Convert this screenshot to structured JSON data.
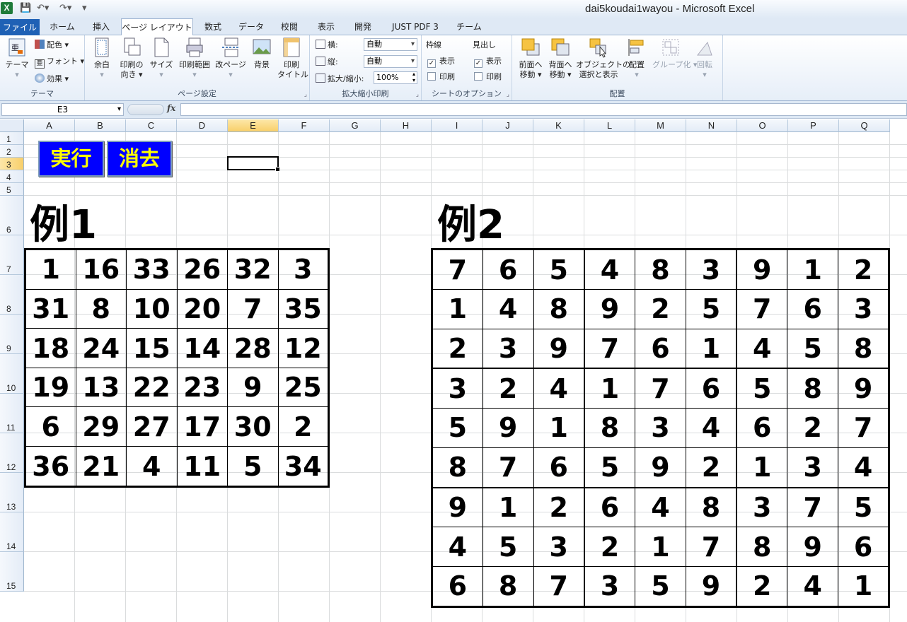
{
  "window": {
    "title": "dai5koudai1wayou - Microsoft Excel"
  },
  "tabs": [
    "ファイル",
    "ホーム",
    "挿入",
    "ページ レイアウト",
    "数式",
    "データ",
    "校閲",
    "表示",
    "開発",
    "JUST PDF 3",
    "チーム"
  ],
  "ribbon": {
    "theme": {
      "label": "テーマ",
      "theme_button": "テーマ",
      "colors": "配色",
      "fonts": "フォント",
      "effects": "効果"
    },
    "page_setup": {
      "label": "ページ設定",
      "margins": "余白",
      "orientation": [
        "印刷の",
        "向き"
      ],
      "size": "サイズ",
      "print_area": "印刷範囲",
      "breaks": "改ページ",
      "background": "背景",
      "print_titles": [
        "印刷",
        "タイトル"
      ]
    },
    "scale": {
      "label": "拡大縮小印刷",
      "width_label": "横:",
      "width_value": "自動",
      "height_label": "縦:",
      "height_value": "自動",
      "scale_label": "拡大/縮小:",
      "scale_value": "100%"
    },
    "sheet_options": {
      "label": "シートのオプション",
      "gridlines": "枠線",
      "headings": "見出し",
      "view": "表示",
      "print": "印刷"
    },
    "arrange": {
      "label": "配置",
      "bring_forward": [
        "前面へ",
        "移動"
      ],
      "send_backward": [
        "背面へ",
        "移動"
      ],
      "selection_pane": [
        "オブジェクトの",
        "選択と表示"
      ],
      "align": "配置",
      "group": "グループ化",
      "rotate": "回転"
    }
  },
  "formula_bar": {
    "name_box": "E3",
    "fx": "fx",
    "value": ""
  },
  "columns": [
    "A",
    "B",
    "C",
    "D",
    "E",
    "F",
    "G",
    "H",
    "I",
    "J",
    "K",
    "L",
    "M",
    "N",
    "O",
    "P",
    "Q"
  ],
  "rows": [
    "1",
    "2",
    "3",
    "4",
    "5",
    "6",
    "7",
    "8",
    "9",
    "10",
    "11",
    "12",
    "13",
    "14",
    "15"
  ],
  "selected_cell": {
    "col": "E",
    "row": "3"
  },
  "buttons": {
    "run": "実行",
    "clear": "消去"
  },
  "example1": {
    "title": "例1",
    "grid": [
      [
        "1",
        "16",
        "33",
        "26",
        "32",
        "3"
      ],
      [
        "31",
        "8",
        "10",
        "20",
        "7",
        "35"
      ],
      [
        "18",
        "24",
        "15",
        "14",
        "28",
        "12"
      ],
      [
        "19",
        "13",
        "22",
        "23",
        "9",
        "25"
      ],
      [
        "6",
        "29",
        "27",
        "17",
        "30",
        "2"
      ],
      [
        "36",
        "21",
        "4",
        "11",
        "5",
        "34"
      ]
    ]
  },
  "example2": {
    "title": "例2",
    "grid": [
      [
        "7",
        "6",
        "5",
        "4",
        "8",
        "3",
        "9",
        "1",
        "2"
      ],
      [
        "1",
        "4",
        "8",
        "9",
        "2",
        "5",
        "7",
        "6",
        "3"
      ],
      [
        "2",
        "3",
        "9",
        "7",
        "6",
        "1",
        "4",
        "5",
        "8"
      ],
      [
        "3",
        "2",
        "4",
        "1",
        "7",
        "6",
        "5",
        "8",
        "9"
      ],
      [
        "5",
        "9",
        "1",
        "8",
        "3",
        "4",
        "6",
        "2",
        "7"
      ],
      [
        "8",
        "7",
        "6",
        "5",
        "9",
        "2",
        "1",
        "3",
        "4"
      ],
      [
        "9",
        "1",
        "2",
        "6",
        "4",
        "8",
        "3",
        "7",
        "5"
      ],
      [
        "4",
        "5",
        "3",
        "2",
        "1",
        "7",
        "8",
        "9",
        "6"
      ],
      [
        "6",
        "8",
        "7",
        "3",
        "5",
        "9",
        "2",
        "4",
        "1"
      ]
    ]
  },
  "colors": {
    "button_bg": "#0000ff",
    "button_text": "#ffff00",
    "file_tab": "#1f61b5"
  }
}
